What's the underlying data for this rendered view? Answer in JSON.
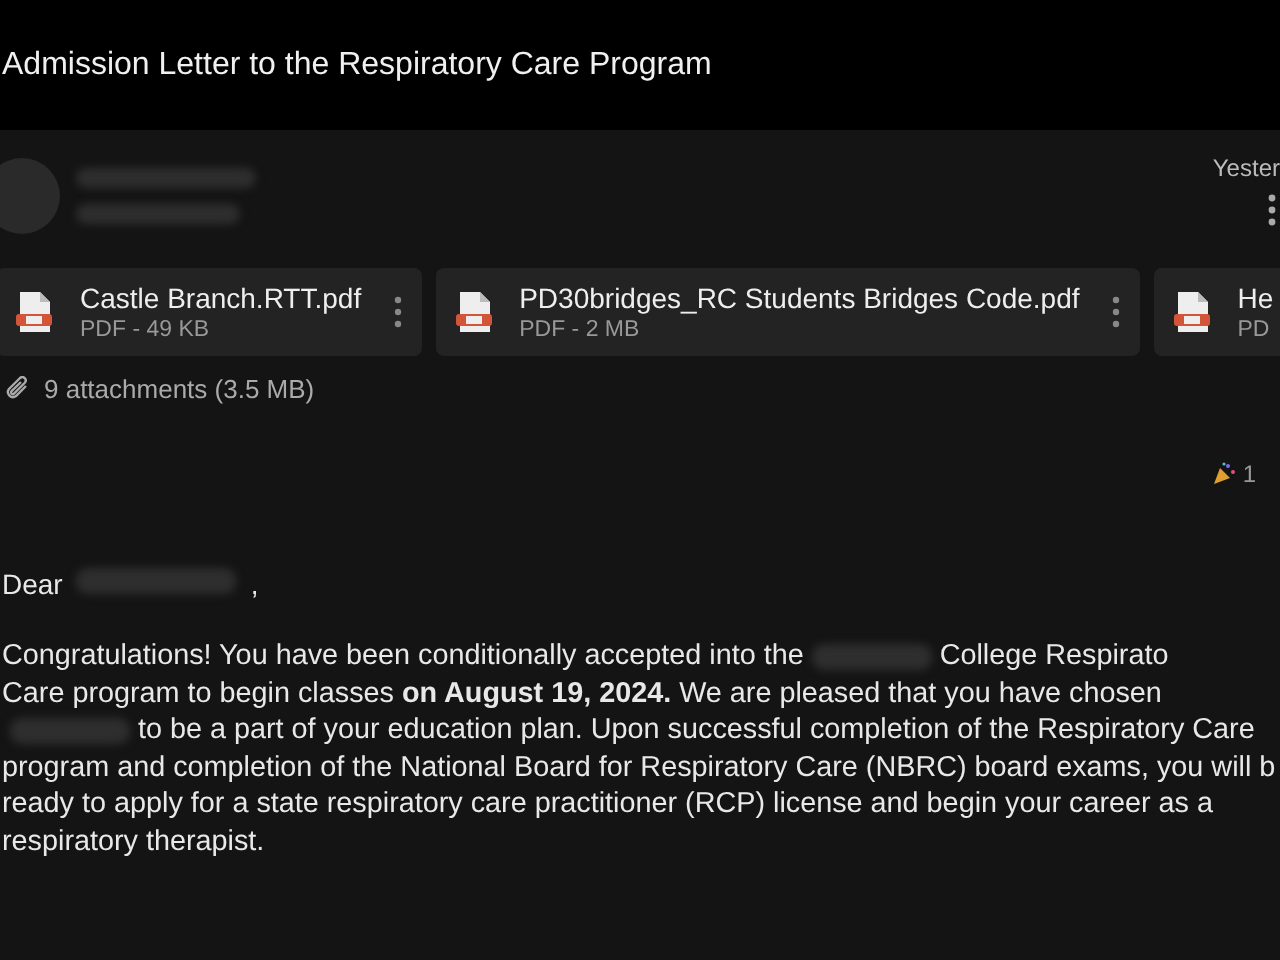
{
  "header": {
    "title": "Admission Letter to the Respiratory Care Program"
  },
  "message": {
    "date": "Yester"
  },
  "attachments": [
    {
      "name": "Castle Branch.RTT.pdf",
      "meta": "PDF - 49 KB"
    },
    {
      "name": "PD30bridges_RC Students Bridges Code.pdf",
      "meta": "PDF - 2 MB"
    },
    {
      "name": "He",
      "meta": "PD"
    }
  ],
  "attachment_summary": "9 attachments (3.5 MB)",
  "reaction": {
    "count": "1"
  },
  "greeting": {
    "before": "Dear",
    "after": ","
  },
  "body_lines": [
    [
      {
        "kind": "text",
        "text": "Congratulations! You have been conditionally accepted into the"
      },
      {
        "kind": "redacted"
      },
      {
        "kind": "text",
        "text": "College Respirato"
      }
    ],
    [
      {
        "kind": "text",
        "text": "Care program to begin classes **on August 19, 2024.** We are pleased that you have chosen"
      }
    ],
    [
      {
        "kind": "redacted"
      },
      {
        "kind": "text",
        "text": "to be a part of your education plan. Upon successful completion of the Respiratory Care"
      }
    ],
    [
      {
        "kind": "text",
        "text": "program and completion of the National Board for Respiratory Care (NBRC) board exams, you will b"
      }
    ],
    [
      {
        "kind": "text",
        "text": "ready to apply for a state respiratory care practitioner (RCP) license and begin your career as a"
      }
    ],
    [
      {
        "kind": "text",
        "text": "respiratory therapist."
      }
    ]
  ]
}
